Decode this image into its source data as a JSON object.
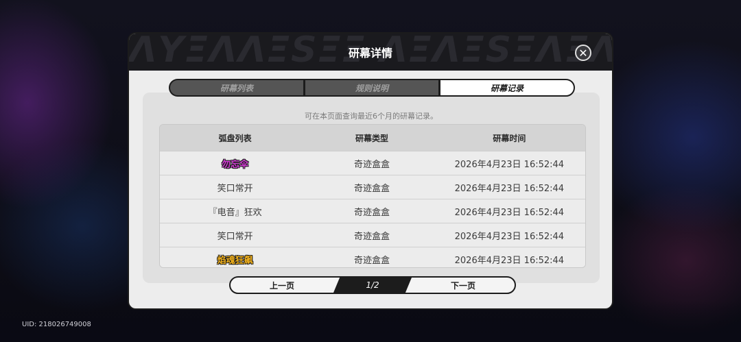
{
  "uid": "UID: 218026749008",
  "modal": {
    "title": "研幕详情",
    "close_label": "✕"
  },
  "tabs": [
    {
      "label": "研幕列表",
      "active": false
    },
    {
      "label": "规则说明",
      "active": false
    },
    {
      "label": "研幕记录",
      "active": true
    }
  ],
  "note": "可在本页面查询最近6个月的研幕记录。",
  "table": {
    "headers": [
      "弧盘列表",
      "研幕类型",
      "研幕时间"
    ],
    "rows": [
      {
        "name": "勿忘伞",
        "type": "奇迹盒盒",
        "time": "2026年4月23日 16:52:44",
        "rarity": "purple"
      },
      {
        "name": "笑口常开",
        "type": "奇迹盒盒",
        "time": "2026年4月23日 16:52:44",
        "rarity": "normal"
      },
      {
        "name": "『电音』狂欢",
        "type": "奇迹盒盒",
        "time": "2026年4月23日 16:52:44",
        "rarity": "normal"
      },
      {
        "name": "笑口常开",
        "type": "奇迹盒盒",
        "time": "2026年4月23日 16:52:44",
        "rarity": "normal"
      },
      {
        "name": "焰魂狂飙",
        "type": "奇迹盒盒",
        "time": "2026年4月23日 16:52:44",
        "rarity": "gold"
      }
    ]
  },
  "pager": {
    "prev_label": "上一页",
    "page": "1/2",
    "next_label": "下一页"
  },
  "colors": {
    "rare_purple": "#d43bd6",
    "rare_gold": "#f3b21c",
    "header_dark": "#1a1a1e"
  }
}
